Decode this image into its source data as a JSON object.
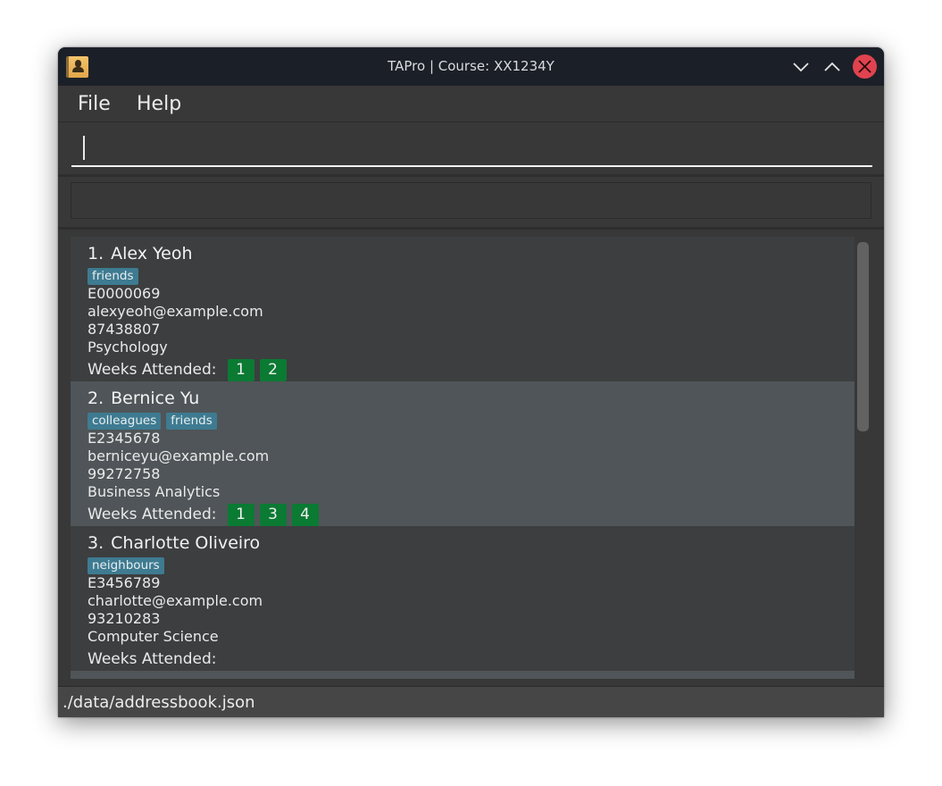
{
  "window": {
    "title": "TAPro | Course: XX1234Y",
    "icon": "address-book-icon",
    "controls": {
      "minimize": "chevron-down-icon",
      "maximize": "chevron-up-icon",
      "close": "close-icon"
    }
  },
  "menu": {
    "file_label": "File",
    "help_label": "Help"
  },
  "command": {
    "value": "",
    "placeholder": ""
  },
  "result": {
    "text": ""
  },
  "persons": [
    {
      "index": "1.",
      "name": "Alex Yeoh",
      "tags": [
        "friends"
      ],
      "id": "E0000069",
      "email": "alexyeoh@example.com",
      "phone": "87438807",
      "major": "Psychology",
      "weeks_label": "Weeks Attended:",
      "weeks": [
        "1",
        "2"
      ]
    },
    {
      "index": "2.",
      "name": "Bernice Yu",
      "tags": [
        "colleagues",
        "friends"
      ],
      "id": "E2345678",
      "email": "berniceyu@example.com",
      "phone": "99272758",
      "major": "Business Analytics",
      "weeks_label": "Weeks Attended:",
      "weeks": [
        "1",
        "3",
        "4"
      ]
    },
    {
      "index": "3.",
      "name": "Charlotte Oliveiro",
      "tags": [
        "neighbours"
      ],
      "id": "E3456789",
      "email": "charlotte@example.com",
      "phone": "93210283",
      "major": "Computer Science",
      "weeks_label": "Weeks Attended:",
      "weeks": []
    }
  ],
  "status": {
    "file_path": "./data/addressbook.json"
  },
  "colors": {
    "tag": "#3e7b91",
    "week_badge": "#0b7a33",
    "close_button": "#e0434f",
    "titlebar": "#1b2028"
  }
}
